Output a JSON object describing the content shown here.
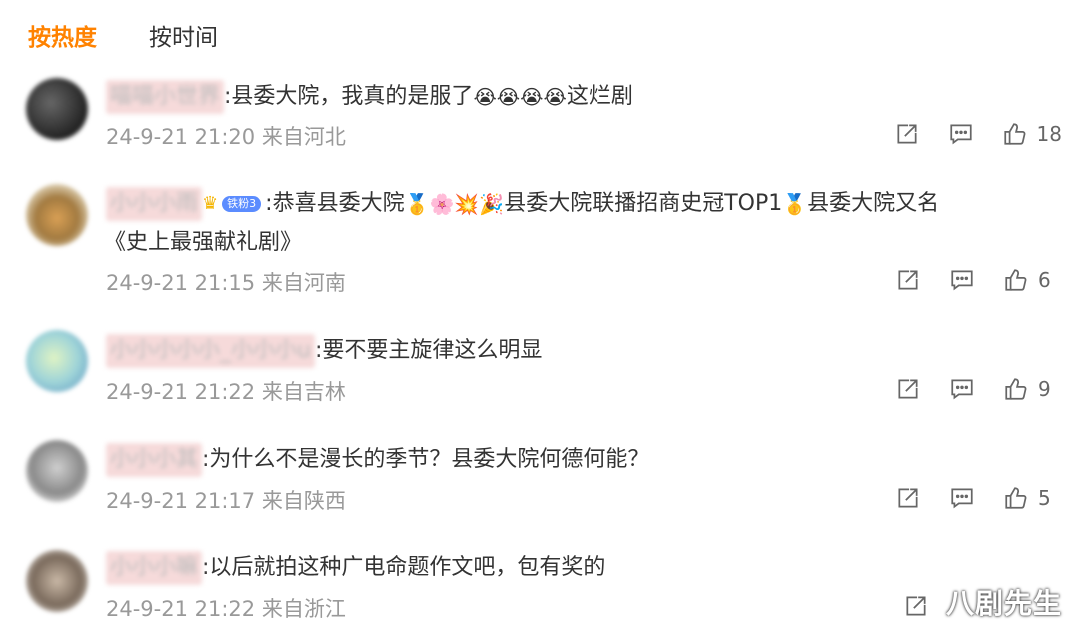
{
  "tabs": [
    {
      "label": "按热度",
      "active": true
    },
    {
      "label": "按时间",
      "active": false
    }
  ],
  "comments": [
    {
      "user": "喵喵小世界",
      "text": ":县委大院，我真的是服了",
      "emojis": "😭😭😭😭",
      "text_after": "这烂剧",
      "meta": "24-9-21 21:20 来自河北",
      "likes": "18"
    },
    {
      "user": "小小小雨",
      "badge": "铁粉3",
      "text": ":恭喜县委大院",
      "emojis": "🥇🌸💥🎉",
      "text_after": "县委大院联播招商史冠TOP1",
      "text_after2": "县委大院又名",
      "line2": "《史上最强献礼剧》",
      "meta": "24-9-21 21:15 来自河南",
      "likes": "6"
    },
    {
      "user": "小小小小小_小小小u",
      "text": ":要不要主旋律这么明显",
      "meta": "24-9-21 21:22 来自吉林",
      "likes": "9"
    },
    {
      "user": "小小小其",
      "text": ":为什么不是漫长的季节？县委大院何德何能？",
      "meta": "24-9-21 21:17 来自陕西",
      "likes": "5"
    },
    {
      "user": "小小小嘛",
      "text": ":以后就拍这种广电命题作文吧，包有奖的",
      "meta": "24-9-21 21:22 来自浙江",
      "likes": ""
    }
  ],
  "watermark": "八剧先生",
  "icons": {
    "share": "share-icon",
    "comment": "comment-icon",
    "like": "thumbs-up-icon"
  },
  "colors": {
    "accent": "#ff8200",
    "meta": "#999999",
    "text": "#333333"
  }
}
